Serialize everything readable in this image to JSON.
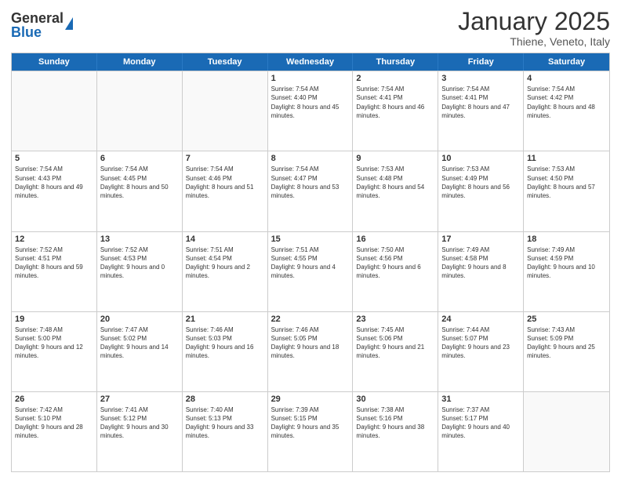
{
  "header": {
    "logo": {
      "general": "General",
      "blue": "Blue"
    },
    "title": "January 2025",
    "location": "Thiene, Veneto, Italy"
  },
  "days_of_week": [
    "Sunday",
    "Monday",
    "Tuesday",
    "Wednesday",
    "Thursday",
    "Friday",
    "Saturday"
  ],
  "weeks": [
    {
      "cells": [
        {
          "day": "",
          "empty": true
        },
        {
          "day": "",
          "empty": true
        },
        {
          "day": "",
          "empty": true
        },
        {
          "day": "1",
          "sunrise": "7:54 AM",
          "sunset": "4:40 PM",
          "daylight": "8 hours and 45 minutes."
        },
        {
          "day": "2",
          "sunrise": "7:54 AM",
          "sunset": "4:41 PM",
          "daylight": "8 hours and 46 minutes."
        },
        {
          "day": "3",
          "sunrise": "7:54 AM",
          "sunset": "4:41 PM",
          "daylight": "8 hours and 47 minutes."
        },
        {
          "day": "4",
          "sunrise": "7:54 AM",
          "sunset": "4:42 PM",
          "daylight": "8 hours and 48 minutes."
        }
      ]
    },
    {
      "cells": [
        {
          "day": "5",
          "sunrise": "7:54 AM",
          "sunset": "4:43 PM",
          "daylight": "8 hours and 49 minutes."
        },
        {
          "day": "6",
          "sunrise": "7:54 AM",
          "sunset": "4:45 PM",
          "daylight": "8 hours and 50 minutes."
        },
        {
          "day": "7",
          "sunrise": "7:54 AM",
          "sunset": "4:46 PM",
          "daylight": "8 hours and 51 minutes."
        },
        {
          "day": "8",
          "sunrise": "7:54 AM",
          "sunset": "4:47 PM",
          "daylight": "8 hours and 53 minutes."
        },
        {
          "day": "9",
          "sunrise": "7:53 AM",
          "sunset": "4:48 PM",
          "daylight": "8 hours and 54 minutes."
        },
        {
          "day": "10",
          "sunrise": "7:53 AM",
          "sunset": "4:49 PM",
          "daylight": "8 hours and 56 minutes."
        },
        {
          "day": "11",
          "sunrise": "7:53 AM",
          "sunset": "4:50 PM",
          "daylight": "8 hours and 57 minutes."
        }
      ]
    },
    {
      "cells": [
        {
          "day": "12",
          "sunrise": "7:52 AM",
          "sunset": "4:51 PM",
          "daylight": "8 hours and 59 minutes."
        },
        {
          "day": "13",
          "sunrise": "7:52 AM",
          "sunset": "4:53 PM",
          "daylight": "9 hours and 0 minutes."
        },
        {
          "day": "14",
          "sunrise": "7:51 AM",
          "sunset": "4:54 PM",
          "daylight": "9 hours and 2 minutes."
        },
        {
          "day": "15",
          "sunrise": "7:51 AM",
          "sunset": "4:55 PM",
          "daylight": "9 hours and 4 minutes."
        },
        {
          "day": "16",
          "sunrise": "7:50 AM",
          "sunset": "4:56 PM",
          "daylight": "9 hours and 6 minutes."
        },
        {
          "day": "17",
          "sunrise": "7:49 AM",
          "sunset": "4:58 PM",
          "daylight": "9 hours and 8 minutes."
        },
        {
          "day": "18",
          "sunrise": "7:49 AM",
          "sunset": "4:59 PM",
          "daylight": "9 hours and 10 minutes."
        }
      ]
    },
    {
      "cells": [
        {
          "day": "19",
          "sunrise": "7:48 AM",
          "sunset": "5:00 PM",
          "daylight": "9 hours and 12 minutes."
        },
        {
          "day": "20",
          "sunrise": "7:47 AM",
          "sunset": "5:02 PM",
          "daylight": "9 hours and 14 minutes."
        },
        {
          "day": "21",
          "sunrise": "7:46 AM",
          "sunset": "5:03 PM",
          "daylight": "9 hours and 16 minutes."
        },
        {
          "day": "22",
          "sunrise": "7:46 AM",
          "sunset": "5:05 PM",
          "daylight": "9 hours and 18 minutes."
        },
        {
          "day": "23",
          "sunrise": "7:45 AM",
          "sunset": "5:06 PM",
          "daylight": "9 hours and 21 minutes."
        },
        {
          "day": "24",
          "sunrise": "7:44 AM",
          "sunset": "5:07 PM",
          "daylight": "9 hours and 23 minutes."
        },
        {
          "day": "25",
          "sunrise": "7:43 AM",
          "sunset": "5:09 PM",
          "daylight": "9 hours and 25 minutes."
        }
      ]
    },
    {
      "cells": [
        {
          "day": "26",
          "sunrise": "7:42 AM",
          "sunset": "5:10 PM",
          "daylight": "9 hours and 28 minutes."
        },
        {
          "day": "27",
          "sunrise": "7:41 AM",
          "sunset": "5:12 PM",
          "daylight": "9 hours and 30 minutes."
        },
        {
          "day": "28",
          "sunrise": "7:40 AM",
          "sunset": "5:13 PM",
          "daylight": "9 hours and 33 minutes."
        },
        {
          "day": "29",
          "sunrise": "7:39 AM",
          "sunset": "5:15 PM",
          "daylight": "9 hours and 35 minutes."
        },
        {
          "day": "30",
          "sunrise": "7:38 AM",
          "sunset": "5:16 PM",
          "daylight": "9 hours and 38 minutes."
        },
        {
          "day": "31",
          "sunrise": "7:37 AM",
          "sunset": "5:17 PM",
          "daylight": "9 hours and 40 minutes."
        },
        {
          "day": "",
          "empty": true
        }
      ]
    }
  ]
}
